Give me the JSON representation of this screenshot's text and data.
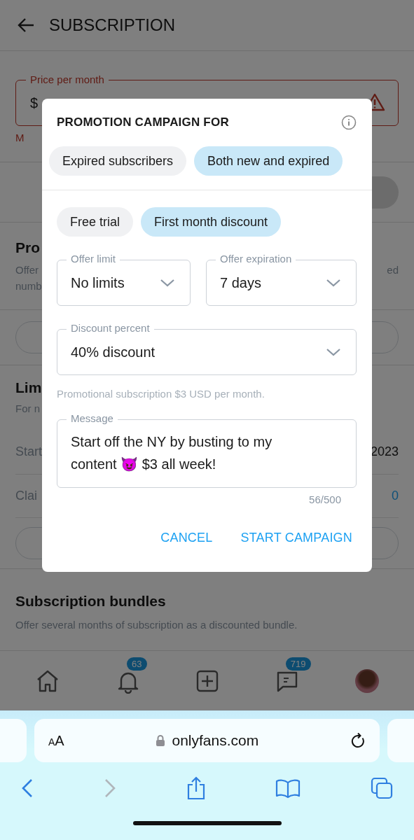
{
  "header": {
    "title": "SUBSCRIPTION"
  },
  "price_field": {
    "label": "Price per month",
    "value": "$",
    "error": "M"
  },
  "profile_promotions": {
    "title": "Pro",
    "description_lines": [
      "Offer",
      "numb"
    ],
    "right_fragment": "ed"
  },
  "limited_offers": {
    "title": "Lim",
    "description": "For n",
    "rows": [
      {
        "label": "Start",
        "value": "2023",
        "kind": "text"
      },
      {
        "label": "Clai",
        "value": "0",
        "kind": "count"
      }
    ]
  },
  "bundles": {
    "title": "Subscription bundles",
    "description": "Offer several months of subscription as a discounted bundle."
  },
  "bottom_nav": [
    {
      "kind": "home"
    },
    {
      "kind": "bell",
      "badge": "63"
    },
    {
      "kind": "add"
    },
    {
      "kind": "messages",
      "badge": "719"
    },
    {
      "kind": "avatar"
    }
  ],
  "modal": {
    "title": "PROMOTION CAMPAIGN FOR",
    "audience": [
      {
        "label": "Expired subscribers",
        "selected": false
      },
      {
        "label": "Both new and expired",
        "selected": true
      }
    ],
    "offer_types": [
      {
        "label": "Free trial",
        "selected": false
      },
      {
        "label": "First month discount",
        "selected": true
      }
    ],
    "offer_limit": {
      "label": "Offer limit",
      "value": "No limits"
    },
    "offer_expiration": {
      "label": "Offer expiration",
      "value": "7 days"
    },
    "discount_percent": {
      "label": "Discount percent",
      "value": "40% discount"
    },
    "note": "Promotional subscription $3 USD per month.",
    "message": {
      "label": "Message",
      "value": "Start off the NY by busting to my content 😈 $3 all week!"
    },
    "counter": "56/500",
    "buttons": [
      "CANCEL",
      "START CAMPAIGN"
    ]
  },
  "browser": {
    "text_size": "AA",
    "url": "onlyfans.com"
  }
}
